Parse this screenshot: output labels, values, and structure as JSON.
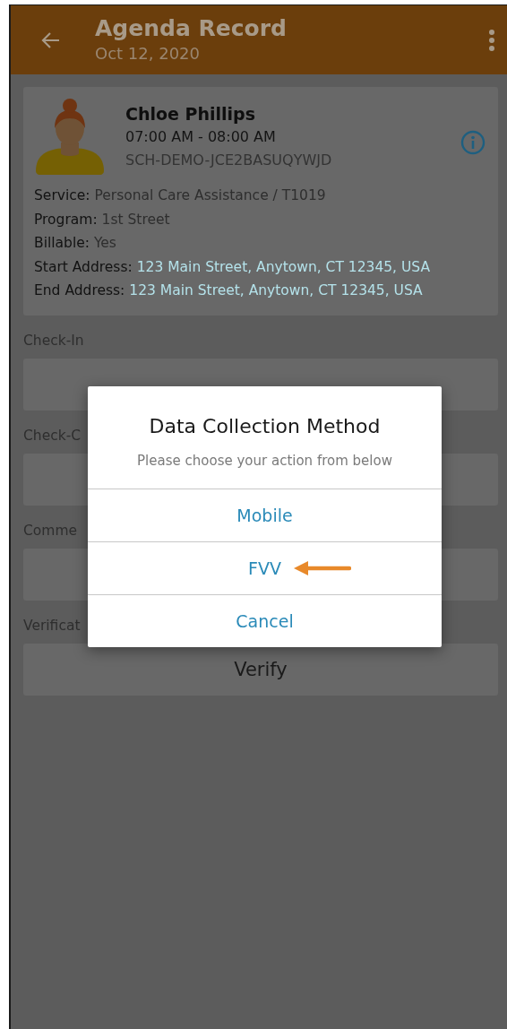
{
  "header": {
    "title": "Agenda Record",
    "subtitle": "Oct 12, 2020"
  },
  "record": {
    "name": "Chloe Phillips",
    "time": "07:00 AM - 08:00 AM",
    "code": "SCH-DEMO-JCE2BASUQYWJD",
    "details": [
      {
        "label": "Service:",
        "value": "Personal Care Assistance / T1019",
        "kind": "text"
      },
      {
        "label": "Program:",
        "value": "1st Street",
        "kind": "text"
      },
      {
        "label": "Billable:",
        "value": "Yes",
        "kind": "text"
      },
      {
        "label": "Start Address:",
        "value": "123 Main Street, Anytown, CT 12345, USA",
        "kind": "address"
      },
      {
        "label": "End Address:",
        "value": "123 Main Street, Anytown, CT 12345, USA",
        "kind": "address"
      }
    ]
  },
  "sections": [
    {
      "label": "Check-In"
    },
    {
      "label": "Check-C"
    },
    {
      "label": "Comme"
    },
    {
      "label": "Verificat",
      "button": "Verify"
    }
  ],
  "dialog": {
    "title": "Data Collection Method",
    "message": "Please choose your action from below",
    "options": [
      {
        "label": "Mobile",
        "pointed": false
      },
      {
        "label": "FVV",
        "pointed": true
      },
      {
        "label": "Cancel",
        "pointed": false
      }
    ]
  }
}
